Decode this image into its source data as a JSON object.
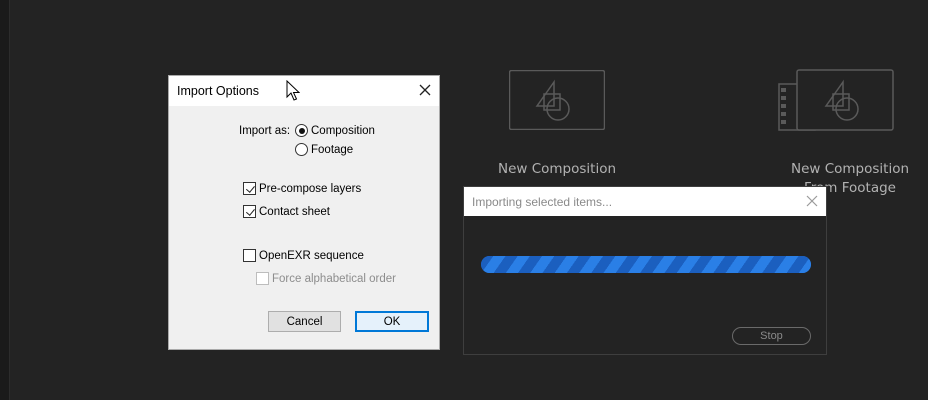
{
  "home": {
    "new_composition_label": "New Composition",
    "new_composition_from_footage_label": "New Composition\nFrom Footage",
    "icons": [
      "composition-icon",
      "film-strip-icon",
      "shapes-icon"
    ]
  },
  "import_options": {
    "title": "Import Options",
    "import_as_label": "Import as:",
    "radio_composition": "Composition",
    "radio_footage": "Footage",
    "selected_import_as": "Composition",
    "precompose_label": "Pre-compose layers",
    "precompose_checked": true,
    "contact_sheet_label": "Contact sheet",
    "contact_sheet_checked": true,
    "openexr_label": "OpenEXR sequence",
    "openexr_checked": false,
    "force_alpha_label": "Force alphabetical order",
    "force_alpha_checked": false,
    "force_alpha_enabled": false,
    "cancel_label": "Cancel",
    "ok_label": "OK"
  },
  "progress": {
    "title": "Importing selected items...",
    "value_fraction": 1.0,
    "stop_label": "Stop"
  },
  "colors": {
    "app_background": "#232323",
    "progress_blue": "#2a7fe6",
    "focus_blue": "#0078d7"
  }
}
